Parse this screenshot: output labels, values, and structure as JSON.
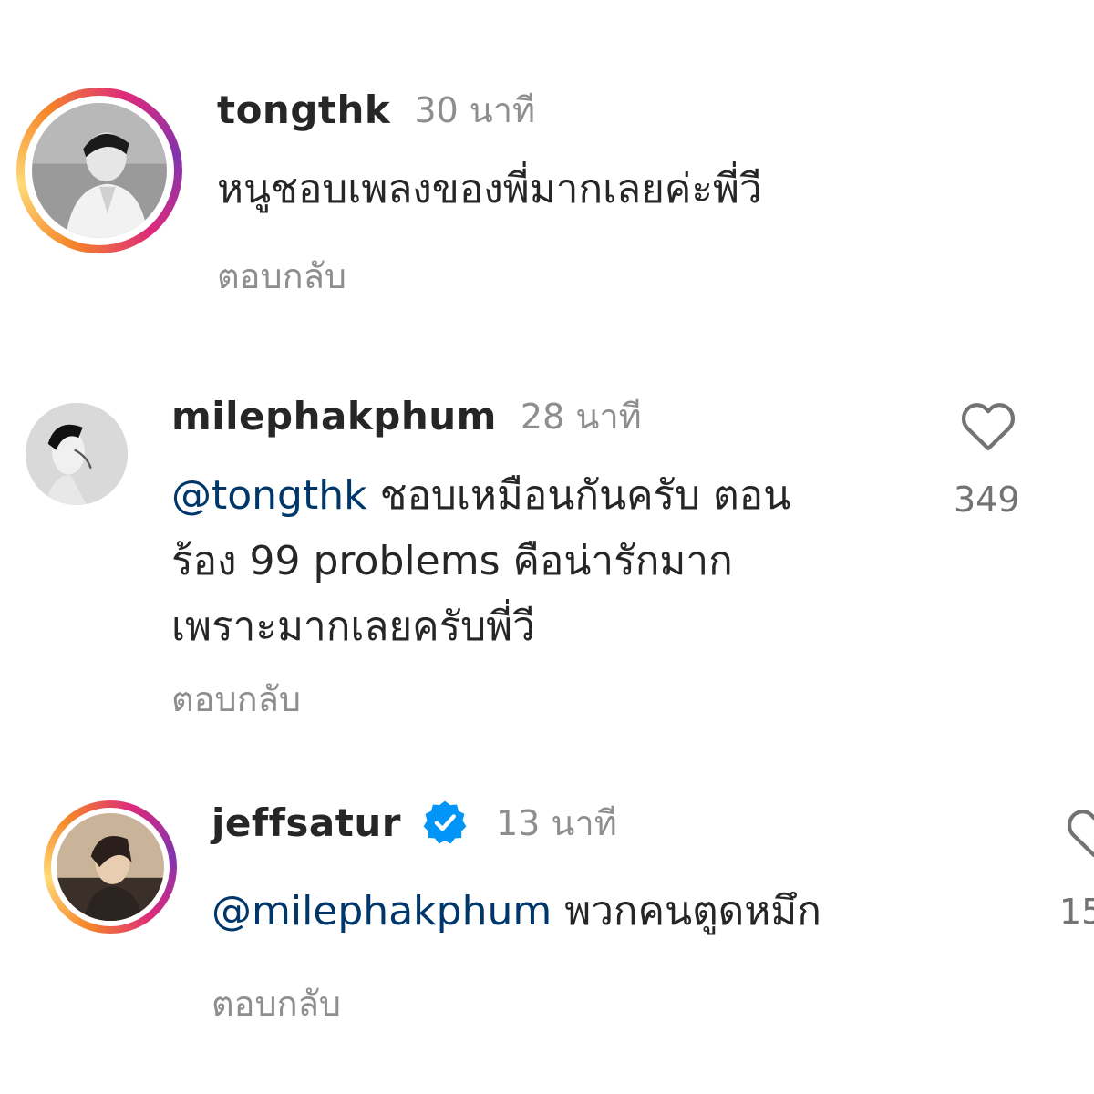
{
  "comments": [
    {
      "username": "tongthk",
      "time": "30 นาที",
      "text": "หนูชอบเพลงของพี่มากเลยค่ะพี่วี",
      "reply_label": "ตอบกลับ",
      "has_story_ring": true,
      "verified": false
    },
    {
      "username": "milephakphum",
      "time": "28 นาที",
      "mention": "@tongthk",
      "text_line1": "ชอบเหมือนกันครับ ตอน",
      "text_line2": "ร้อง 99 problems คือน่ารักมาก",
      "text_line3": "เพราะมากเลยครับพี่วี",
      "reply_label": "ตอบกลับ",
      "like_count": "349",
      "has_story_ring": false,
      "verified": false
    },
    {
      "username": "jeffsatur",
      "time": "13 นาที",
      "mention": "@milephakphum",
      "text": "พวกคนตูดหมึก",
      "reply_label": "ตอบกลับ",
      "like_count": "15",
      "has_story_ring": true,
      "verified": true
    }
  ],
  "colors": {
    "mention": "#00376b",
    "verified_badge": "#0095f6",
    "secondary_text": "#8e8e8e"
  },
  "icons": [
    "heart-outline-icon",
    "verified-badge-icon"
  ]
}
